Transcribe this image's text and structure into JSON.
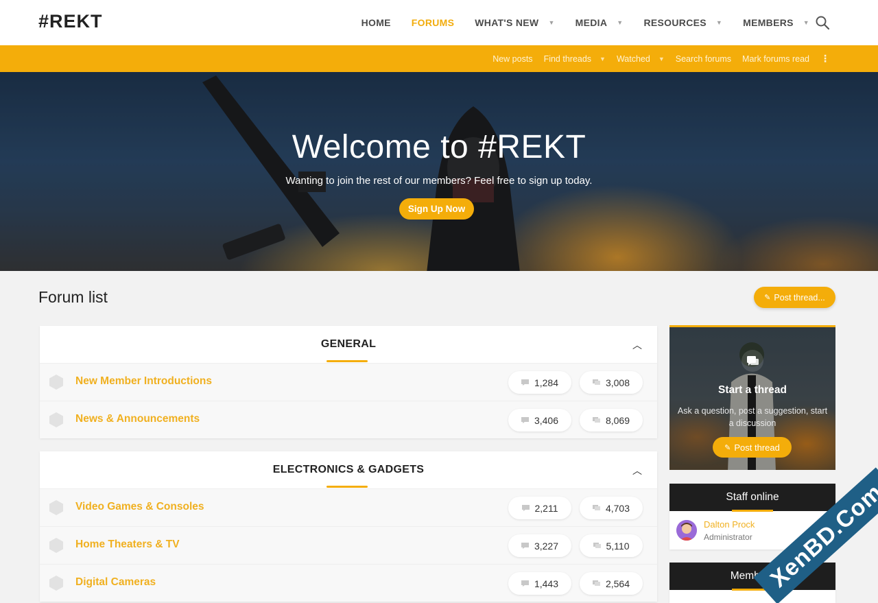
{
  "header": {
    "logo": "#REKT",
    "nav": [
      {
        "label": "HOME",
        "active": false,
        "has_menu": false
      },
      {
        "label": "FORUMS",
        "active": true,
        "has_menu": false
      },
      {
        "label": "WHAT'S NEW",
        "active": false,
        "has_menu": true
      },
      {
        "label": "MEDIA",
        "active": false,
        "has_menu": true
      },
      {
        "label": "RESOURCES",
        "active": false,
        "has_menu": true
      },
      {
        "label": "MEMBERS",
        "active": false,
        "has_menu": true
      }
    ],
    "search_icon": "search-icon"
  },
  "subnav": {
    "items": [
      {
        "label": "New posts",
        "has_menu": false
      },
      {
        "label": "Find threads",
        "has_menu": true
      },
      {
        "label": "Watched",
        "has_menu": true
      },
      {
        "label": "Search forums",
        "has_menu": false
      },
      {
        "label": "Mark forums read",
        "has_menu": false
      }
    ],
    "more_icon": "vertical-dots-icon"
  },
  "hero": {
    "title": "Welcome to #REKT",
    "subtitle": "Wanting to join the rest of our members? Feel free to sign up today.",
    "cta": "Sign Up Now"
  },
  "page": {
    "title": "Forum list",
    "post_thread": "Post thread..."
  },
  "categories": [
    {
      "title": "GENERAL",
      "forums": [
        {
          "title": "New Member Introductions",
          "threads": "1,284",
          "messages": "3,008"
        },
        {
          "title": "News & Announcements",
          "threads": "3,406",
          "messages": "8,069"
        }
      ]
    },
    {
      "title": "ELECTRONICS & GADGETS",
      "forums": [
        {
          "title": "Video Games & Consoles",
          "threads": "2,211",
          "messages": "4,703"
        },
        {
          "title": "Home Theaters & TV",
          "threads": "3,227",
          "messages": "5,110"
        },
        {
          "title": "Digital Cameras",
          "threads": "1,443",
          "messages": "2,564"
        }
      ]
    }
  ],
  "sidebar": {
    "start_thread": {
      "title": "Start a thread",
      "description": "Ask a question, post a suggestion, start a discussion",
      "button": "Post thread"
    },
    "staff_online": {
      "title": "Staff online",
      "members": [
        {
          "name": "Dalton Prock",
          "role": "Administrator"
        }
      ]
    },
    "members_online": {
      "title": "Members"
    }
  },
  "watermark": "XenBD.Com",
  "colors": {
    "accent": "#f4ad0a",
    "dark": "#1e1e1e",
    "link": "#f0b020"
  }
}
